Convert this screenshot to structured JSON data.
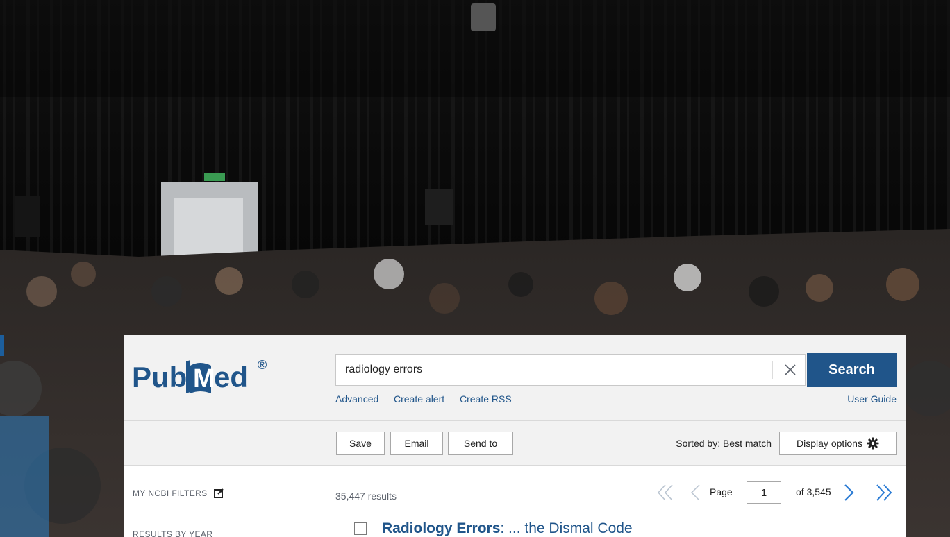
{
  "header": {
    "logo_text": "PubMed",
    "logo_mark": "®",
    "search": {
      "value": "radiology errors",
      "placeholder": ""
    },
    "search_button_label": "Search",
    "links": {
      "advanced": "Advanced",
      "create_alert": "Create alert",
      "create_rss": "Create RSS",
      "user_guide": "User Guide"
    }
  },
  "toolbar": {
    "save_label": "Save",
    "email_label": "Email",
    "send_to_label": "Send to",
    "sort_label": "Sorted by: Best match",
    "display_options_label": "Display options"
  },
  "sidebar": {
    "filters_label": "MY NCBI FILTERS",
    "results_by_year_label": "RESULTS BY YEAR"
  },
  "results": {
    "count_label": "35,447 results",
    "pagination": {
      "page_label": "Page",
      "current_page": "1",
      "of_label": "of 3,545"
    },
    "first_result": {
      "title_bold": "Radiology Errors",
      "title_rest": ": ... the Dismal Code"
    }
  },
  "colors": {
    "brand_blue": "#20558a",
    "header_bg": "#f2f2f2"
  },
  "icons": {
    "clear": "close-icon",
    "external": "external-link-icon",
    "settings": "gear-icon",
    "first": "double-chevron-left-icon",
    "prev": "chevron-left-icon",
    "next": "chevron-right-icon",
    "last": "double-chevron-right-icon"
  }
}
